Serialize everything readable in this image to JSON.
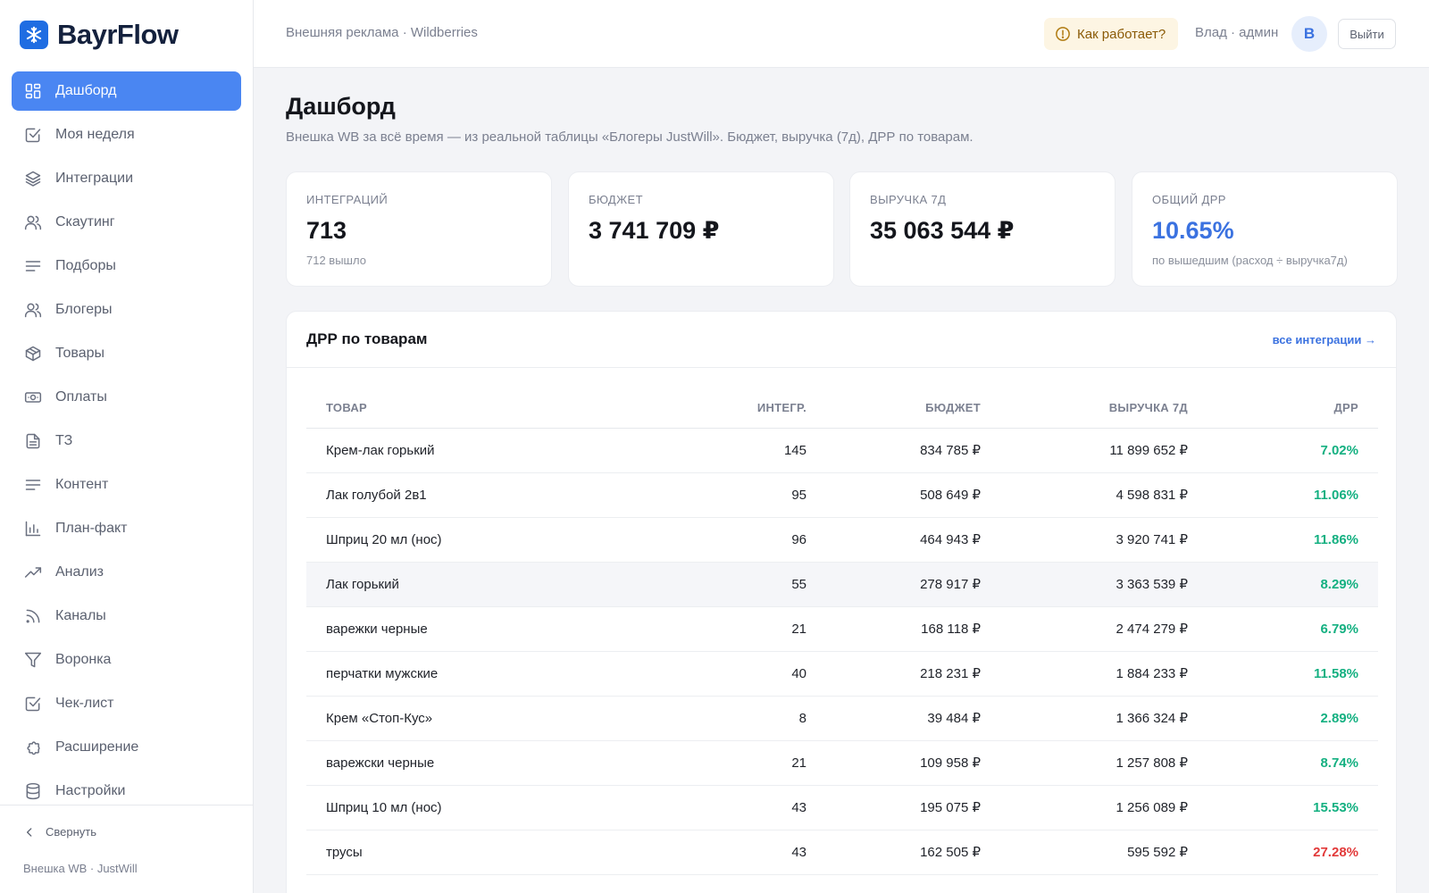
{
  "brand": {
    "name": "BayrFlow"
  },
  "sidebar": {
    "items": [
      {
        "label": "Дашборд",
        "icon": "dashboard-grid-icon",
        "active": true
      },
      {
        "label": "Моя неделя",
        "icon": "check-square-icon"
      },
      {
        "label": "Интеграции",
        "icon": "layers-icon"
      },
      {
        "label": "Скаутинг",
        "icon": "users-icon"
      },
      {
        "label": "Подборы",
        "icon": "list-lines-icon"
      },
      {
        "label": "Блогеры",
        "icon": "users-icon"
      },
      {
        "label": "Товары",
        "icon": "box-icon"
      },
      {
        "label": "Оплаты",
        "icon": "banknote-icon"
      },
      {
        "label": "ТЗ",
        "icon": "document-icon"
      },
      {
        "label": "Контент",
        "icon": "list-lines-icon"
      },
      {
        "label": "План-факт",
        "icon": "bar-chart-icon"
      },
      {
        "label": "Анализ",
        "icon": "trending-up-icon"
      },
      {
        "label": "Каналы",
        "icon": "rss-icon"
      },
      {
        "label": "Воронка",
        "icon": "funnel-icon"
      },
      {
        "label": "Чек-лист",
        "icon": "check-square-icon"
      },
      {
        "label": "Расширение",
        "icon": "puzzle-icon"
      },
      {
        "label": "Настройки",
        "icon": "database-icon"
      }
    ],
    "collapse_label": "Свернуть",
    "footer": "Внешка WB · JustWill"
  },
  "topbar": {
    "breadcrumb": "Внешняя реклама · Wildberries",
    "help_label": "Как работает?",
    "user_label": "Влад · админ",
    "avatar_letter": "В",
    "logout_label": "Выйти"
  },
  "page": {
    "title": "Дашборд",
    "subtitle": "Внешка WB за всё время — из реальной таблицы «Блогеры JustWill». Бюджет, выручка (7д), ДРР по товарам."
  },
  "stats": [
    {
      "label": "Интеграций",
      "value": "713",
      "note": "712 вышло"
    },
    {
      "label": "Бюджет",
      "value": "3 741 709 ₽",
      "note": ""
    },
    {
      "label": "Выручка 7д",
      "value": "35 063 544 ₽",
      "note": ""
    },
    {
      "label": "Общий ДРР",
      "value": "10.65%",
      "note": "по вышедшим (расход ÷ выручка7д)"
    }
  ],
  "table": {
    "title": "ДРР по товарам",
    "link_label": "все интеграции →",
    "columns": [
      "Товар",
      "Интегр.",
      "Бюджет",
      "Выручка 7д",
      "ДРР"
    ],
    "rows": [
      {
        "product": "Крем-лак горький",
        "integrations": "145",
        "budget": "834 785 ₽",
        "revenue": "11 899 652 ₽",
        "drr": "7.02%",
        "status": "good"
      },
      {
        "product": "Лак голубой 2в1",
        "integrations": "95",
        "budget": "508 649 ₽",
        "revenue": "4 598 831 ₽",
        "drr": "11.06%",
        "status": "good"
      },
      {
        "product": "Шприц 20 мл (нос)",
        "integrations": "96",
        "budget": "464 943 ₽",
        "revenue": "3 920 741 ₽",
        "drr": "11.86%",
        "status": "good"
      },
      {
        "product": "Лак горький",
        "integrations": "55",
        "budget": "278 917 ₽",
        "revenue": "3 363 539 ₽",
        "drr": "8.29%",
        "status": "good"
      },
      {
        "product": "варежки черные",
        "integrations": "21",
        "budget": "168 118 ₽",
        "revenue": "2 474 279 ₽",
        "drr": "6.79%",
        "status": "good"
      },
      {
        "product": "перчатки мужские",
        "integrations": "40",
        "budget": "218 231 ₽",
        "revenue": "1 884 233 ₽",
        "drr": "11.58%",
        "status": "good"
      },
      {
        "product": "Крем «Стоп-Кус»",
        "integrations": "8",
        "budget": "39 484 ₽",
        "revenue": "1 366 324 ₽",
        "drr": "2.89%",
        "status": "good"
      },
      {
        "product": "варежски черные",
        "integrations": "21",
        "budget": "109 958 ₽",
        "revenue": "1 257 808 ₽",
        "drr": "8.74%",
        "status": "good"
      },
      {
        "product": "Шприц 10 мл (нос)",
        "integrations": "43",
        "budget": "195 075 ₽",
        "revenue": "1 256 089 ₽",
        "drr": "15.53%",
        "status": "good"
      },
      {
        "product": "трусы",
        "integrations": "43",
        "budget": "162 505 ₽",
        "revenue": "595 592 ₽",
        "drr": "27.28%",
        "status": "bad"
      }
    ],
    "highlighted_row": 3
  },
  "colors": {
    "accent": "#4a86f2",
    "good": "#14b081",
    "bad": "#e23a3a"
  }
}
